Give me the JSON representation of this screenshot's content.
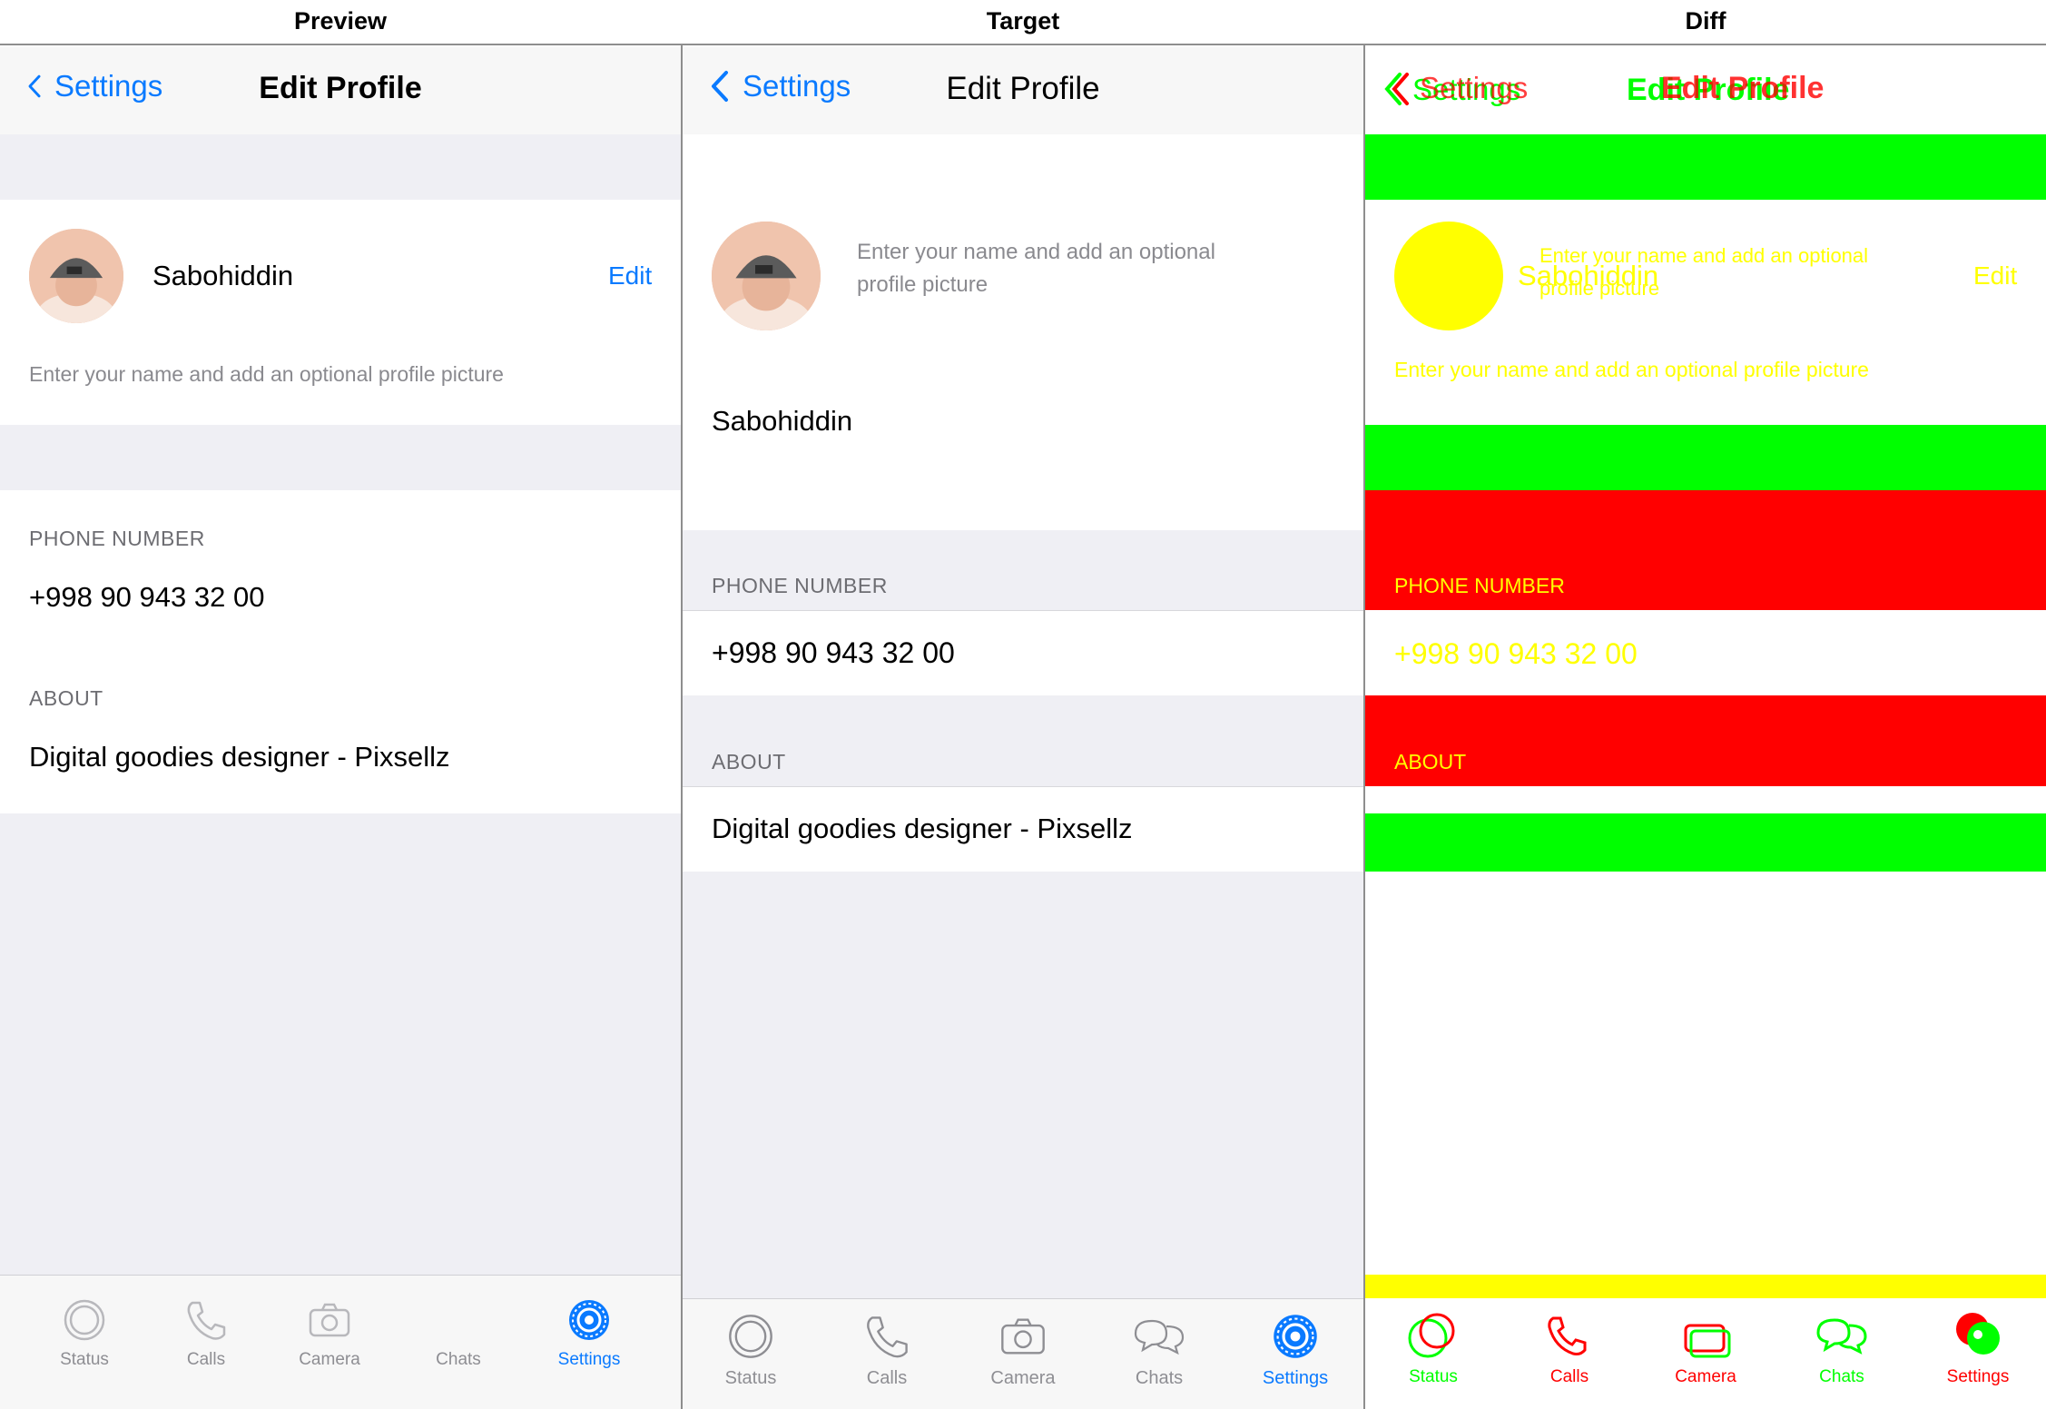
{
  "captions": {
    "preview": "Preview",
    "target": "Target",
    "diff": "Diff"
  },
  "nav": {
    "back_label": "Settings",
    "title": "Edit Profile"
  },
  "profile": {
    "name": "Sabohiddin",
    "edit_label": "Edit",
    "hint": "Enter your name and add an optional profile picture",
    "hint_line1": "Enter your name and add an optional",
    "hint_line2": "profile picture"
  },
  "phone": {
    "label": "PHONE NUMBER",
    "value": "+998 90 943 32 00"
  },
  "about": {
    "label": "ABOUT",
    "value": "Digital goodies designer - Pixsellz"
  },
  "tabs": [
    {
      "label": "Status",
      "icon": "status-icon"
    },
    {
      "label": "Calls",
      "icon": "phone-icon"
    },
    {
      "label": "Camera",
      "icon": "camera-icon"
    },
    {
      "label": "Chats",
      "icon": "chats-icon"
    },
    {
      "label": "Settings",
      "icon": "gear-icon"
    }
  ],
  "active_tab": "Settings",
  "colors": {
    "accent": "#0a7aff",
    "background": "#efeff4",
    "diff_added": "#00ff00",
    "diff_removed": "#ff0000",
    "diff_changed": "#ffff00"
  }
}
